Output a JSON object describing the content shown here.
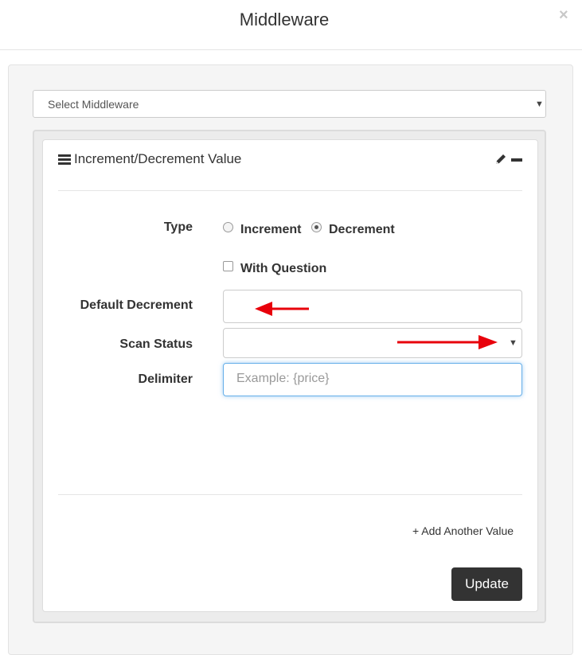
{
  "modal": {
    "title": "Middleware",
    "close_label": "×"
  },
  "middleware_select": {
    "value": "Select Middleware"
  },
  "panel": {
    "title": "Increment/Decrement Value",
    "form": {
      "type_label": "Type",
      "type_options": [
        {
          "label": "Increment",
          "checked": false
        },
        {
          "label": "Decrement",
          "checked": true
        }
      ],
      "with_question_label": "With Question",
      "with_question_checked": false,
      "default_decrement_label": "Default Decrement",
      "default_decrement_value": "",
      "scan_status_label": "Scan Status",
      "scan_status_value": "",
      "delimiter_label": "Delimiter",
      "delimiter_placeholder": "Example: {price}",
      "delimiter_value": ""
    },
    "add_link": "+ Add Another Value",
    "update_label": "Update"
  },
  "annotation_color": "#e8000b"
}
